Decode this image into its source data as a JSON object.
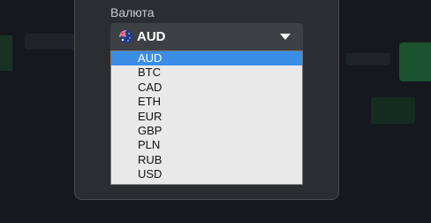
{
  "currency_field": {
    "label": "Валюта",
    "selected": "AUD",
    "selected_flag_icon": "australia-flag-icon",
    "caret_icon": "caret-down-icon"
  },
  "dropdown": {
    "options": [
      "AUD",
      "BTC",
      "CAD",
      "ETH",
      "EUR",
      "GBP",
      "PLN",
      "RUB",
      "USD"
    ],
    "highlighted_index": 0
  },
  "colors": {
    "highlight": "#3a8ee6",
    "modal_bg": "#2b2d31",
    "select_bg": "#3d4045",
    "list_bg": "#e9e9e9"
  }
}
